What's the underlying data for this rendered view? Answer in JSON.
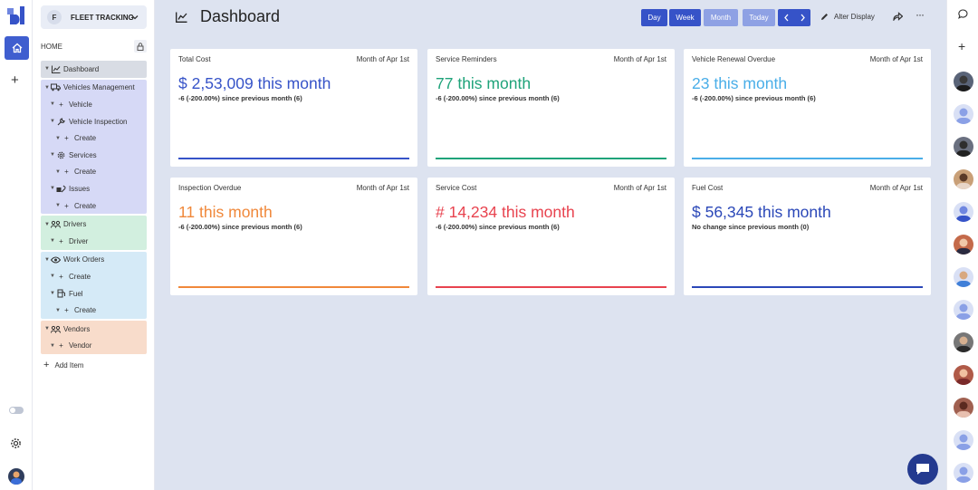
{
  "app": {
    "badge_letter": "F",
    "name": "FLEET TRACKING"
  },
  "sidebar": {
    "home_label": "HOME",
    "add_item_label": "Add Item",
    "items": {
      "dashboard": "Dashboard",
      "vehicles_management": "Vehicles Management",
      "vehicle": "Vehicle",
      "vehicle_inspection": "Vehicle Inspection",
      "create_1": "Create",
      "services": "Services",
      "create_2": "Create",
      "issues": "Issues",
      "create_3": "Create",
      "drivers": "Drivers",
      "driver": "Driver",
      "work_orders": "Work Orders",
      "create_4": "Create",
      "fuel": "Fuel",
      "create_5": "Create",
      "vendors": "Vendors",
      "vendor": "Vendor"
    }
  },
  "header": {
    "title": "Dashboard",
    "buttons": {
      "day": "Day",
      "week": "Week",
      "month": "Month",
      "today": "Today"
    },
    "alter_display": "Alter Display"
  },
  "cards": [
    {
      "label": "Total Cost",
      "period": "Month of Apr 1st",
      "value": "$ 2,53,009 this month",
      "change": "-6 (-200.00%) since previous month (6)",
      "color": "#3653c8"
    },
    {
      "label": "Service Reminders",
      "period": "Month of Apr 1st",
      "value": "77 this month",
      "change": "-6 (-200.00%) since previous month (6)",
      "color": "#1fa37a"
    },
    {
      "label": "Vehicle Renewal Overdue",
      "period": "Month of Apr 1st",
      "value": "23 this month",
      "change": "-6 (-200.00%) since previous month (6)",
      "color": "#4aaee8"
    },
    {
      "label": "Inspection Overdue",
      "period": "Month of Apr 1st",
      "value": "11 this month",
      "change": "-6 (-200.00%) since previous month (6)",
      "color": "#f0883a"
    },
    {
      "label": "Service Cost",
      "period": "Month of Apr 1st",
      "value": "# 14,234 this month",
      "change": "-6 (-200.00%) since previous month (6)",
      "color": "#e8434f"
    },
    {
      "label": "Fuel Cost",
      "period": "Month of Apr 1st",
      "value": "$ 56,345 this month",
      "change": "No change since previous month (0)",
      "color": "#2b48b8"
    }
  ],
  "colors": {
    "accent": "#3653c8",
    "accent_light": "#8ea1e4",
    "fab": "#243a8f"
  },
  "icons": [
    "dashboard-chart-icon",
    "home-icon",
    "plus-icon",
    "lock-icon",
    "chevron-down-icon",
    "truck-icon",
    "wrench-icon",
    "gear-icon",
    "tools-icon",
    "group-icon",
    "eye-icon",
    "fuel-icon",
    "pencil-icon",
    "share-icon",
    "more-icon",
    "chat-icon",
    "chat-bubble-icon"
  ]
}
